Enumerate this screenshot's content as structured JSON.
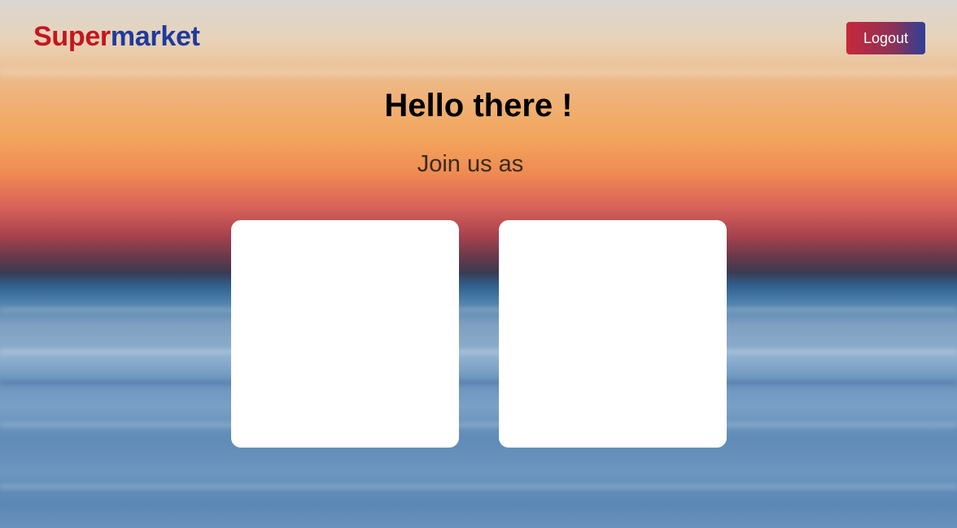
{
  "header": {
    "logo": {
      "part1": "Super",
      "part2": "market"
    },
    "logout_label": "Logout"
  },
  "main": {
    "title": "Hello there !",
    "subtitle": "Join us as",
    "cards": [
      {
        "label": ""
      },
      {
        "label": ""
      }
    ]
  },
  "colors": {
    "logo_red": "#c4161c",
    "logo_blue": "#1e3a9c",
    "button_gradient_start": "#c7283a",
    "button_gradient_end": "#2c3f99"
  }
}
